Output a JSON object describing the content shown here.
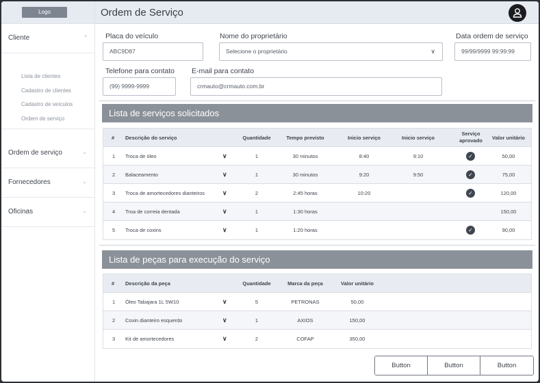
{
  "sidebar": {
    "logo": "Logo",
    "menu": [
      {
        "label": "Cliente",
        "chevron": "^"
      },
      {
        "label": "Ordem de serviço",
        "chevron": "⌄"
      },
      {
        "label": "Fornecedores",
        "chevron": "⌄"
      },
      {
        "label": "Oficinas",
        "chevron": "⌄"
      }
    ],
    "submenu": [
      "Lista de clientes",
      "Cadastro de clientes",
      "Cadastro de veículos",
      "Ordem de serviço"
    ]
  },
  "header": {
    "title": "Ordem de Serviço",
    "avatar_icon": "user-icon"
  },
  "form": {
    "placa": {
      "label": "Placa do veículo",
      "value": "ABC9D87"
    },
    "proprietario": {
      "label": "Nome do proprietário",
      "value": "Selecione o proprietário"
    },
    "data": {
      "label": "Data ordem de serviço",
      "value": "99/99/9999 99:99:99"
    },
    "telefone": {
      "label": "Telefone para contato",
      "value": "(99) 9999-9999"
    },
    "email": {
      "label": "E-mail para contato",
      "value": "crmauto@crmauto.com.br"
    }
  },
  "services": {
    "title": "Lista de serviços solicitados",
    "headers": {
      "num": "#",
      "desc": "Descrição do serviço",
      "qtd": "Quantidade",
      "tempo": "Tempo previsto",
      "inicio1": "Inicio serviço",
      "inicio2": "Inicio serviço",
      "aprovado1": "Serviço",
      "aprovado2": "aprovado",
      "valor": "Valor unitário"
    },
    "rows": [
      {
        "num": "1",
        "desc": "Troca de óleo",
        "qtd": "1",
        "tempo": "30 minutos",
        "inicio1": "8:40",
        "inicio2": "9:10",
        "aprovado": true,
        "valor": "50,00"
      },
      {
        "num": "2",
        "desc": "Balaceamento",
        "qtd": "1",
        "tempo": "30 minutos",
        "inicio1": "9:20",
        "inicio2": "9:50",
        "aprovado": true,
        "valor": "75,00"
      },
      {
        "num": "3",
        "desc": "Troca de amortecedores dianteiros",
        "qtd": "2",
        "tempo": "2:45 horas",
        "inicio1": "10:20",
        "inicio2": "",
        "aprovado": true,
        "valor": "120,00"
      },
      {
        "num": "4",
        "desc": "Troa de correia dentada",
        "qtd": "1",
        "tempo": "1:30 horas",
        "inicio1": "",
        "inicio2": "",
        "aprovado": false,
        "valor": "150,00"
      },
      {
        "num": "5",
        "desc": "Troca de coxins",
        "qtd": "1",
        "tempo": "1:20 horas",
        "inicio1": "",
        "inicio2": "",
        "aprovado": true,
        "valor": "90,00"
      }
    ]
  },
  "parts": {
    "title": "Lista de peças para execução do serviço",
    "headers": {
      "num": "#",
      "desc": "Descrição da peça",
      "qtd": "Quantidade",
      "marca": "Marca da peça",
      "valor": "Valor unitário"
    },
    "rows": [
      {
        "num": "1",
        "desc": "Óleo Tabajara 1L 5W10",
        "qtd": "5",
        "marca": "PETRONAS",
        "valor": "50,00"
      },
      {
        "num": "2",
        "desc": "Coxin dianteiro esquerdo",
        "qtd": "1",
        "marca": "AXIOS",
        "valor": "150,00"
      },
      {
        "num": "3",
        "desc": "Kit de amortecedores",
        "qtd": "2",
        "marca": "COFAP",
        "valor": "350,00"
      }
    ]
  },
  "buttons": [
    "Button",
    "Button",
    "Button"
  ],
  "colors": {
    "header_bg": "#e6eaf1",
    "section_bar": "#8b9199",
    "check": "#3f4650"
  }
}
